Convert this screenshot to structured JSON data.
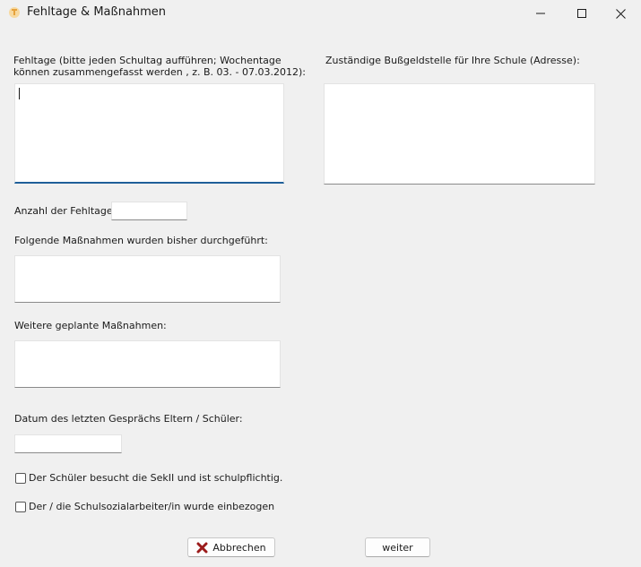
{
  "window": {
    "title": "Fehltage & Maßnahmen"
  },
  "form": {
    "fehltage_label_line1": "Fehltage (bitte jeden Schultag aufführen; Wochentage",
    "fehltage_label_line2": "können zusammengefasst werden , z. B. 03. - 07.03.2012):",
    "fehltage_value": "",
    "bussgeld_label": "Zuständige Bußgeldstelle für Ihre Schule (Adresse):",
    "bussgeld_value": "",
    "anzahl_label": "Anzahl der Fehltage:",
    "anzahl_value": "",
    "bisher_label": "Folgende Maßnahmen wurden bisher durchgeführt:",
    "bisher_value": "",
    "geplant_label": "Weitere geplante Maßnahmen:",
    "geplant_value": "",
    "datum_label": "Datum des letzten Gesprächs Eltern / Schüler:",
    "datum_value": "",
    "sek2_label": "Der Schüler besucht die SekII und ist schulpflichtig.",
    "sozial_label": "Der / die Schulsozialarbeiter/in wurde einbezogen"
  },
  "buttons": {
    "cancel_label": "Abbrechen",
    "next_label": "weiter"
  },
  "colors": {
    "accent": "#1f5f99",
    "cancel_icon": "#9b1b1b",
    "app_icon": "#e6a23c"
  },
  "icons": {
    "app": "app-icon",
    "cancel": "red-x-icon"
  }
}
